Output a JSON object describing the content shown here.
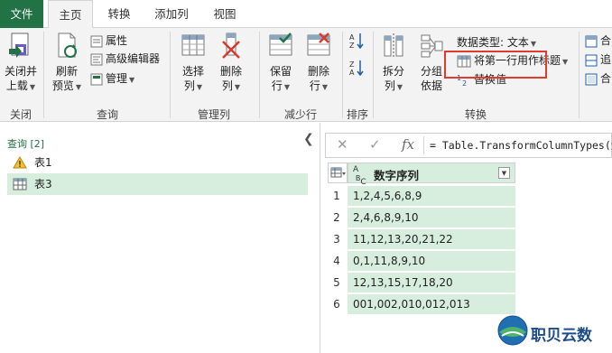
{
  "tabs": [
    "文件",
    "主页",
    "转换",
    "添加列",
    "视图"
  ],
  "ribbon": {
    "close": {
      "label1": "关闭并",
      "label2": "上载",
      "group": "关闭"
    },
    "refresh": {
      "label1": "刷新",
      "label2": "预览"
    },
    "properties": "属性",
    "advanced_editor": "高级编辑器",
    "manage": "管理",
    "query_group": "查询",
    "choose_columns": {
      "label1": "选择",
      "label2": "列"
    },
    "remove_columns": {
      "label1": "删除",
      "label2": "列"
    },
    "manage_columns_group": "管理列",
    "keep_rows": {
      "label1": "保留",
      "label2": "行"
    },
    "remove_rows": {
      "label1": "删除",
      "label2": "行"
    },
    "reduce_rows_group": "减少行",
    "sort_group": "排序",
    "split": {
      "label1": "拆分",
      "label2": "列"
    },
    "group_by": {
      "label1": "分组",
      "label2": "依据"
    },
    "data_type": "数据类型: 文本",
    "first_row_header": "将第一行用作标题",
    "replace_values": "替换值",
    "transform_group": "转换",
    "right_items": [
      "合",
      "追",
      "合"
    ]
  },
  "queries": {
    "header": "查询 [2]",
    "items": [
      {
        "name": "表1",
        "icon": "warning-icon"
      },
      {
        "name": "表3",
        "icon": "table-icon"
      }
    ]
  },
  "formula_bar": {
    "formula": "= Table.TransformColumnTypes(源,"
  },
  "table": {
    "type_badge": "A\nBC",
    "column": "数字序列",
    "rows": [
      {
        "n": "1",
        "v": "1,2,4,5,6,8,9"
      },
      {
        "n": "2",
        "v": "2,4,6,8,9,10"
      },
      {
        "n": "3",
        "v": "11,12,13,20,21,22"
      },
      {
        "n": "4",
        "v": "0,1,11,8,9,10"
      },
      {
        "n": "5",
        "v": "12,13,15,17,18,20"
      },
      {
        "n": "6",
        "v": "001,002,010,012,013"
      }
    ]
  },
  "brand": "职贝云数",
  "colors": {
    "accent": "#217346",
    "selection": "#d7eedf",
    "highlight_box": "#e23b2e"
  }
}
